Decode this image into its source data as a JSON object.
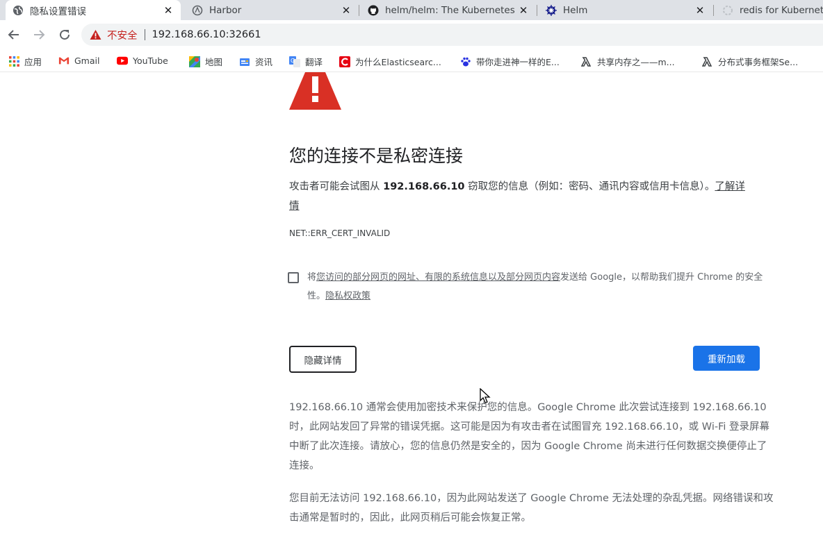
{
  "tabs": [
    {
      "title": "隐私设置错误",
      "icon": "globe-icon",
      "active": true
    },
    {
      "title": "Harbor",
      "icon": "harbor-icon",
      "active": false
    },
    {
      "title": "helm/helm: The Kubernetes",
      "icon": "github-icon",
      "active": false
    },
    {
      "title": "Helm",
      "icon": "helm-icon",
      "active": false
    },
    {
      "title": "redis for Kubernetes",
      "icon": "loading-icon",
      "active": false
    }
  ],
  "omnibox": {
    "security_label": "不安全",
    "url": "192.168.66.10:32661"
  },
  "bookmarks": [
    {
      "label": "应用",
      "icon": "apps-grid-icon"
    },
    {
      "label": "Gmail",
      "icon": "gmail-icon"
    },
    {
      "label": "YouTube",
      "icon": "youtube-icon"
    },
    {
      "label": "地图",
      "icon": "maps-icon"
    },
    {
      "label": "资讯",
      "icon": "news-icon"
    },
    {
      "label": "翻译",
      "icon": "translate-icon"
    },
    {
      "label": "为什么Elasticsearc...",
      "icon": "csdn-icon"
    },
    {
      "label": "带你走进神一样的E...",
      "icon": "paw-icon"
    },
    {
      "label": "共享内存之——m...",
      "icon": "lambda-icon"
    },
    {
      "label": "分布式事务框架Se...",
      "icon": "lambda-icon"
    }
  ],
  "interstitial": {
    "heading": "您的连接不是私密连接",
    "primary_before": "攻击者可能会试图从 ",
    "primary_host": "192.168.66.10",
    "primary_after": " 窃取您的信息（例如：密码、通讯内容或信用卡信息）。",
    "learn_more": "了解详情",
    "error_code": "NET::ERR_CERT_INVALID",
    "optin_prefix": "将",
    "optin_link": "您访问的部分网页的网址、有限的系统信息以及部分网页内容",
    "optin_suffix": "发送给 Google，以帮助我们提升 Chrome 的安全性。",
    "privacy_policy": "隐私权政策",
    "hide_details_button": "隐藏详情",
    "reload_button": "重新加载",
    "details_1": "192.168.66.10 通常会使用加密技术来保护您的信息。Google Chrome 此次尝试连接到 192.168.66.10 时，此网站发回了异常的错误凭据。这可能是因为有攻击者在试图冒充 192.168.66.10，或 Wi-Fi 登录屏幕中断了此次连接。请放心，您的信息仍然是安全的，因为 Google Chrome 尚未进行任何数据交换便停止了连接。",
    "details_2": "您目前无法访问 192.168.66.10，因为此网站发送了 Google Chrome 无法处理的杂乱凭据。网络错误和攻击通常是暂时的，因此，此网页稍后可能会恢复正常。"
  },
  "colors": {
    "warning_red": "#d93025",
    "button_blue": "#1a73e8",
    "insecure_red": "#c5221f"
  }
}
